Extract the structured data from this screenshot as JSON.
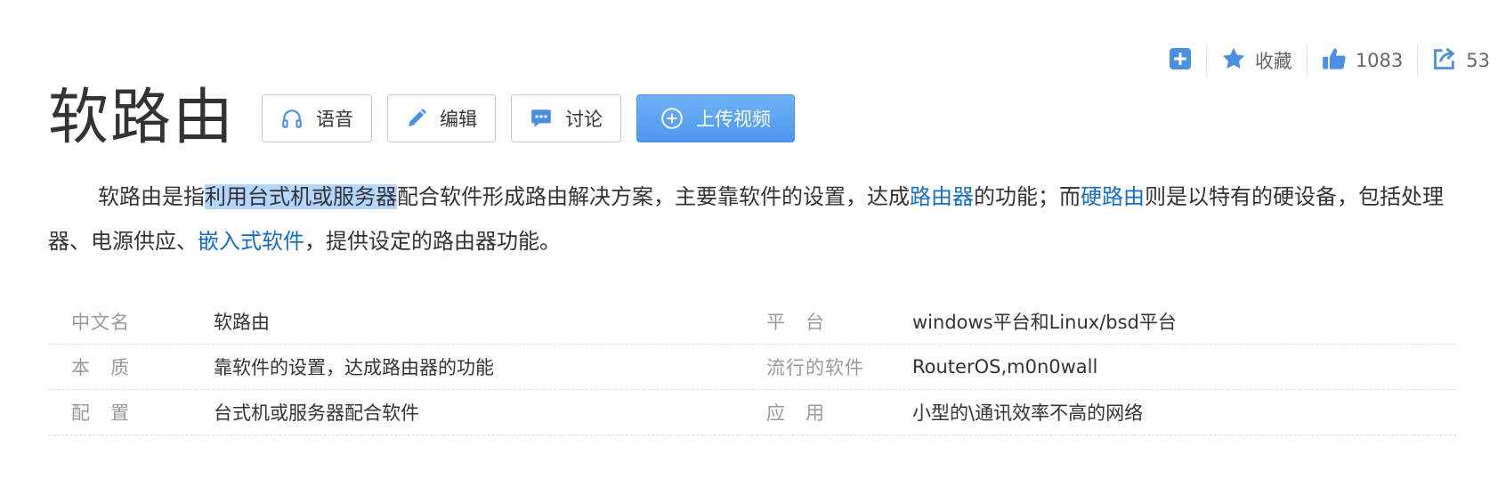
{
  "toolbar": {
    "favorite_label": "收藏",
    "like_count": "1083",
    "share_count": "53",
    "accent": "#4a90e2"
  },
  "title": "软路由",
  "buttons": {
    "voice": "语音",
    "edit": "编辑",
    "discuss": "讨论",
    "upload_video": "上传视频"
  },
  "summary": {
    "p1": "软路由是指",
    "hl": "利用台式机或服务器",
    "p2": "配合软件形成路由解决方案，主要靠软件的设置，达成",
    "link_router": "路由器",
    "p3": "的功能；而",
    "link_hw": "硬路由",
    "p4": "则是以特有的硬设备，包括处理器、电源供应、",
    "link_embedded": "嵌入式软件",
    "p5": "，提供设定的路由器功能。"
  },
  "info_left": [
    {
      "name": "中文名",
      "value": "软路由"
    },
    {
      "name": "本　质",
      "value": "靠软件的设置，达成路由器的功能"
    },
    {
      "name": "配　置",
      "value": "台式机或服务器配合软件"
    }
  ],
  "info_right": [
    {
      "name": "平　台",
      "value": "windows平台和Linux/bsd平台"
    },
    {
      "name": "流行的软件",
      "value": "RouterOS,m0n0wall"
    },
    {
      "name": "应　用",
      "value": "小型的\\通讯效率不高的网络"
    }
  ]
}
